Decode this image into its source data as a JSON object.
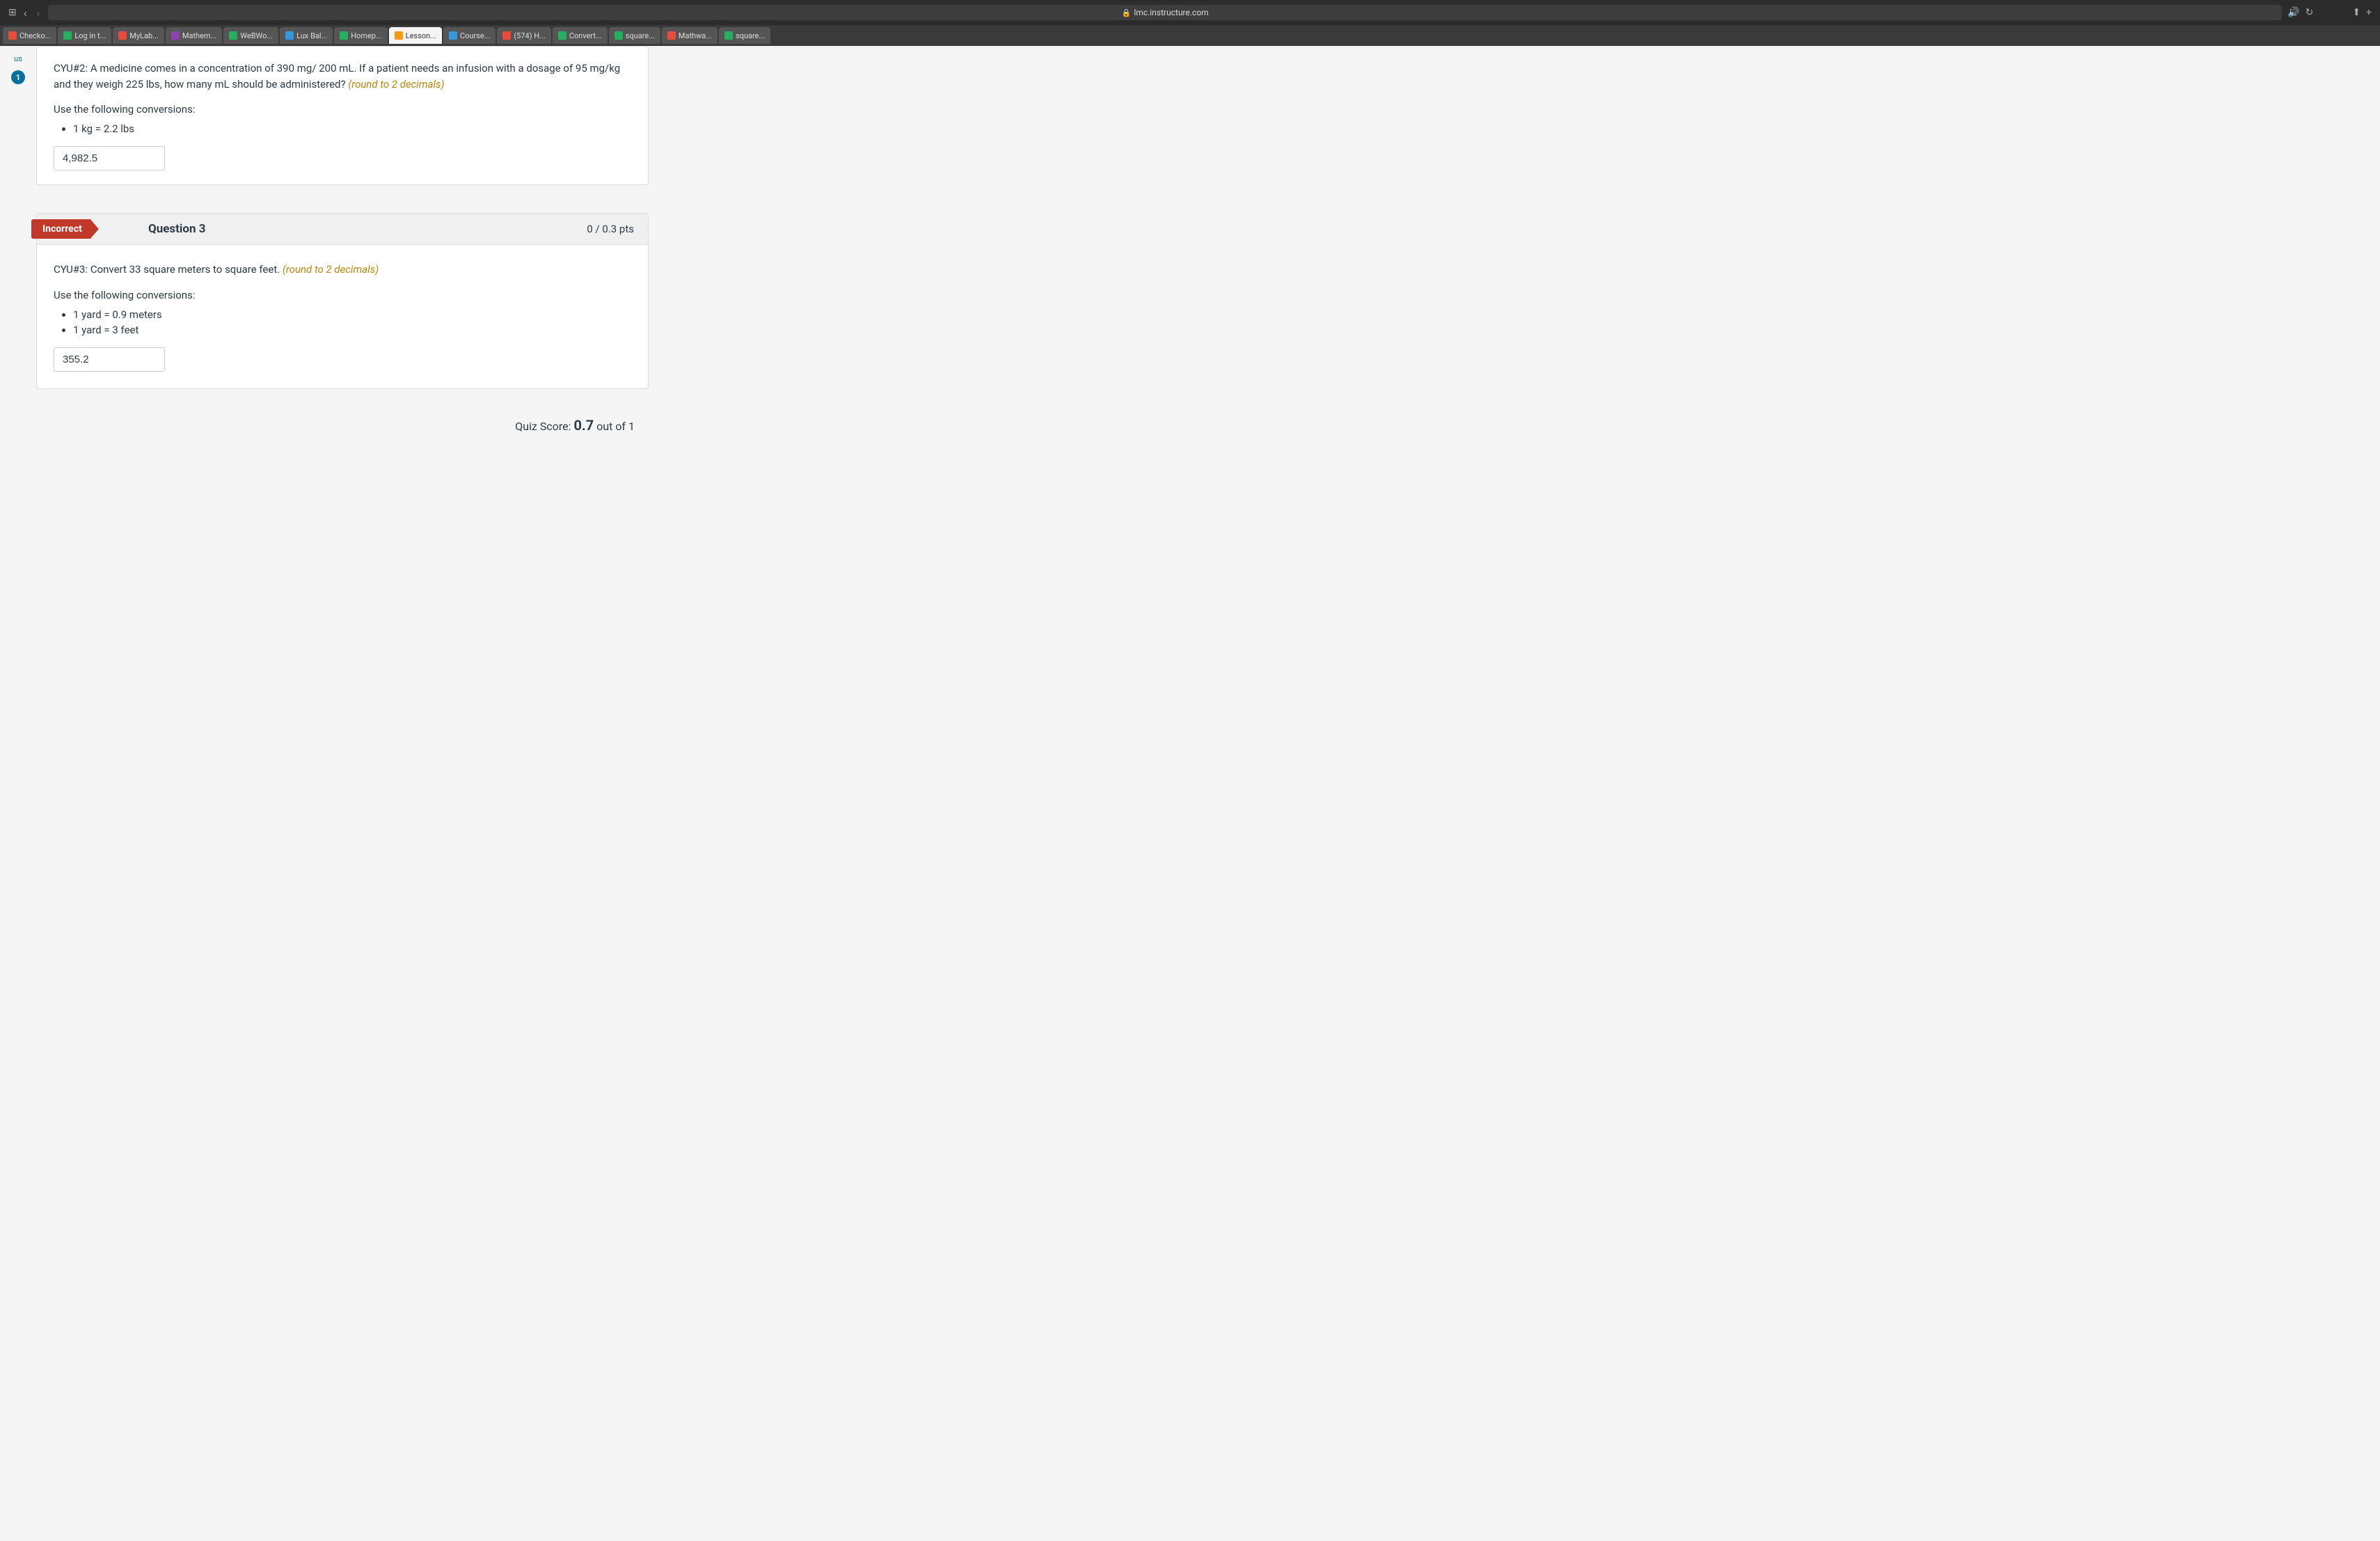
{
  "browser": {
    "url": "lmc.instructure.com",
    "shield_icon": "🛡",
    "audio_icon": "🔊",
    "refresh_icon": "↻",
    "share_icon": "⬆",
    "new_tab_icon": "+",
    "sidebar_icon": "⊞"
  },
  "tabs": [
    {
      "label": "Checko...",
      "color": "#e74c3c",
      "active": false
    },
    {
      "label": "Log in t...",
      "color": "#27ae60",
      "active": false
    },
    {
      "label": "MyLab...",
      "color": "#e74c3c",
      "active": false
    },
    {
      "label": "Mathem...",
      "color": "#8e44ad",
      "active": false
    },
    {
      "label": "WeBWo...",
      "color": "#27ae60",
      "active": false
    },
    {
      "label": "Lux Bal...",
      "color": "#3498db",
      "active": false
    },
    {
      "label": "Homep...",
      "color": "#27ae60",
      "active": false
    },
    {
      "label": "Lesson...",
      "color": "#f39c12",
      "active": true
    },
    {
      "label": "Course...",
      "color": "#3498db",
      "active": false
    },
    {
      "label": "(574) H...",
      "color": "#e74c3c",
      "active": false
    },
    {
      "label": "Convert...",
      "color": "#27ae60",
      "active": false
    },
    {
      "label": "square...",
      "color": "#27ae60",
      "active": false
    },
    {
      "label": "Mathwa...",
      "color": "#e74c3c",
      "active": false
    },
    {
      "label": "square...",
      "color": "#27ae60",
      "active": false
    }
  ],
  "sidebar": {
    "us_label": "us",
    "badge_count": "1"
  },
  "question2_partial": {
    "question_text": "CYU#2: A medicine comes in a concentration of 390 mg/ 200 mL. If a patient needs an infusion with a dosage of 95 mg/kg and they weigh 225 lbs, how many mL should be administered?",
    "highlight": "(round to 2 decimals)",
    "conversions_label": "Use the following conversions:",
    "conversions": [
      "1 kg = 2.2 lbs"
    ],
    "answer_value": "4,982.5"
  },
  "question3": {
    "status": "Incorrect",
    "title": "Question 3",
    "points": "0 / 0.3 pts",
    "question_text": "CYU#3: Convert 33 square meters to square feet.",
    "highlight": "(round to 2 decimals)",
    "conversions_label": "Use the following conversions:",
    "conversions": [
      "1 yard = 0.9 meters",
      "1 yard = 3 feet"
    ],
    "answer_value": "355.2"
  },
  "quiz_score": {
    "label": "Quiz Score:",
    "value": "0.7",
    "suffix": "out of 1"
  }
}
